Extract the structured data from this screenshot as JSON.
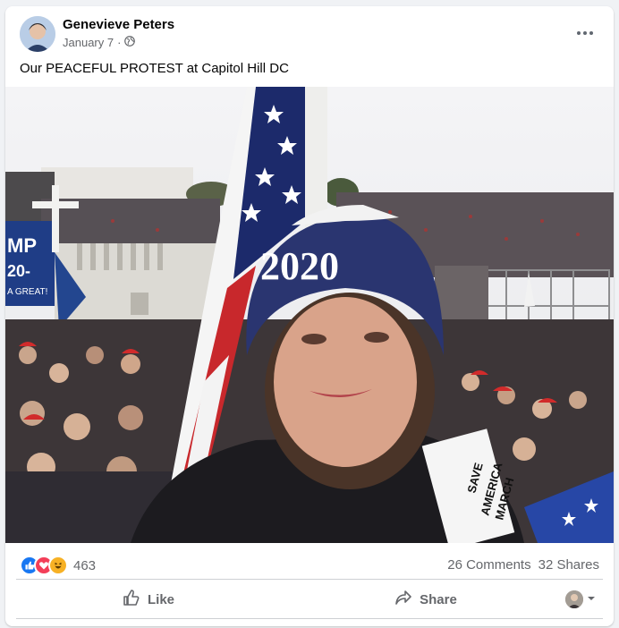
{
  "post": {
    "author": "Genevieve Peters",
    "date": "January 7",
    "separator": "·",
    "privacy_icon": "globe-icon",
    "more_icon": "more-options-icon",
    "caption": "Our PEACEFUL PROTEST at Capitol Hill DC"
  },
  "photo": {
    "hat_text": "2020",
    "badge_text_1": "SAVE",
    "badge_text_2": "AMERICA",
    "badge_text_3": "MARCH",
    "banner_text_1": "MP",
    "banner_text_2": "20-",
    "banner_text_3": "A GREAT!"
  },
  "stats": {
    "reaction_icons": [
      "like-icon",
      "love-icon",
      "haha-icon"
    ],
    "reaction_count": "463",
    "comments": "26 Comments",
    "shares": "32 Shares"
  },
  "actions": {
    "like_label": "Like",
    "share_label": "Share"
  },
  "colors": {
    "facebook_blue": "#1877f2",
    "love_red": "#f33e58",
    "haha_yellow": "#f7b125",
    "secondary_text": "#65676b"
  }
}
